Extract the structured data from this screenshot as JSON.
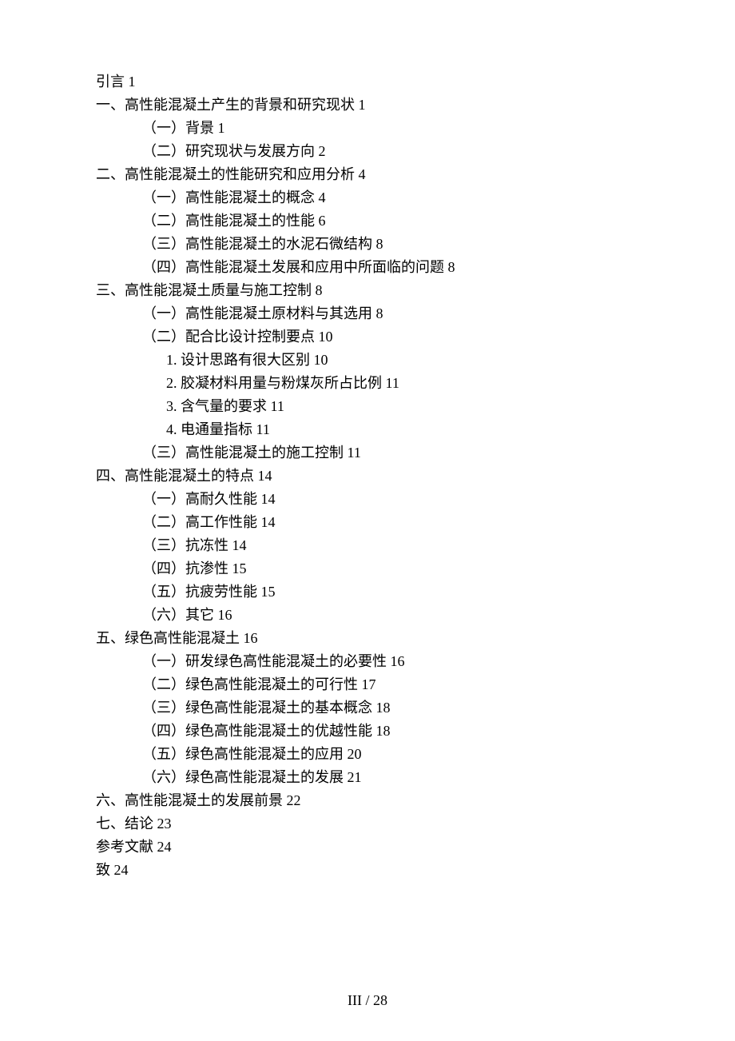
{
  "toc": [
    {
      "level": 0,
      "label": "引言",
      "page": "1"
    },
    {
      "level": 0,
      "label": "一、高性能混凝土产生的背景和研究现状",
      "page": "1"
    },
    {
      "level": 1,
      "label": "（一）背景",
      "page": "1"
    },
    {
      "level": 1,
      "label": "（二）研究现状与发展方向",
      "page": "2"
    },
    {
      "level": 0,
      "label": "二、高性能混凝土的性能研究和应用分析",
      "page": "4"
    },
    {
      "level": 1,
      "label": "（一）高性能混凝土的概念",
      "page": "4"
    },
    {
      "level": 1,
      "label": "（二）高性能混凝土的性能",
      "page": "6"
    },
    {
      "level": 1,
      "label": "（三）高性能混凝土的水泥石微结构",
      "page": "8"
    },
    {
      "level": 1,
      "label": "（四）高性能混凝土发展和应用中所面临的问题",
      "page": "8"
    },
    {
      "level": 0,
      "label": "三、高性能混凝土质量与施工控制",
      "page": "8"
    },
    {
      "level": 1,
      "label": "（一）高性能混凝土原材料与其选用",
      "page": "8"
    },
    {
      "level": 1,
      "label": "（二）配合比设计控制要点",
      "page": "10"
    },
    {
      "level": 2,
      "label": "1. 设计思路有很大区别",
      "page": "10"
    },
    {
      "level": 2,
      "label": "2. 胶凝材料用量与粉煤灰所占比例",
      "page": "11"
    },
    {
      "level": 2,
      "label": "3. 含气量的要求",
      "page": "11"
    },
    {
      "level": 2,
      "label": "4. 电通量指标",
      "page": "11"
    },
    {
      "level": 1,
      "label": "（三）高性能混凝土的施工控制",
      "page": "11"
    },
    {
      "level": 0,
      "label": "四、高性能混凝土的特点",
      "page": "14"
    },
    {
      "level": 1,
      "label": "（一）高耐久性能",
      "page": "14"
    },
    {
      "level": 1,
      "label": "（二）高工作性能",
      "page": "14"
    },
    {
      "level": 1,
      "label": "（三）抗冻性",
      "page": "14"
    },
    {
      "level": 1,
      "label": "（四）抗渗性",
      "page": "15"
    },
    {
      "level": 1,
      "label": "（五）抗疲劳性能",
      "page": "15"
    },
    {
      "level": 1,
      "label": "（六）其它",
      "page": "16"
    },
    {
      "level": 0,
      "label": "五、绿色高性能混凝土",
      "page": "16"
    },
    {
      "level": 1,
      "label": "（一）研发绿色高性能混凝土的必要性",
      "page": "16"
    },
    {
      "level": 1,
      "label": "（二）绿色高性能混凝土的可行性",
      "page": "17"
    },
    {
      "level": 1,
      "label": "（三）绿色高性能混凝土的基本概念",
      "page": "18"
    },
    {
      "level": 1,
      "label": "（四）绿色高性能混凝土的优越性能",
      "page": "18"
    },
    {
      "level": 1,
      "label": "（五）绿色高性能混凝土的应用",
      "page": "20"
    },
    {
      "level": 1,
      "label": "（六）绿色高性能混凝土的发展",
      "page": "21"
    },
    {
      "level": 0,
      "label": "六、高性能混凝土的发展前景",
      "page": "22"
    },
    {
      "level": 0,
      "label": "七、结论",
      "page": "23"
    },
    {
      "level": 0,
      "label": "参考文献",
      "page": "24"
    },
    {
      "level": 0,
      "label": "致",
      "page": "24"
    }
  ],
  "footer": "III / 28"
}
